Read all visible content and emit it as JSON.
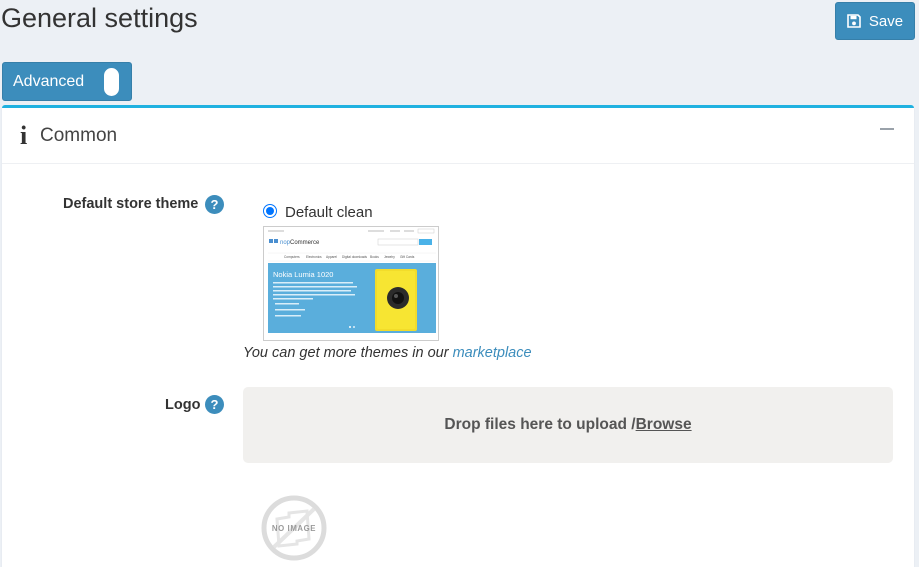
{
  "header": {
    "title": "General settings",
    "save_label": "Save",
    "advanced_label": "Advanced",
    "advanced_on": true
  },
  "card": {
    "title": "Common",
    "accent_color": "#1fb1e0"
  },
  "theme": {
    "label": "Default store theme",
    "option_label": "Default clean",
    "selected": true,
    "preview": {
      "logo_part1": "nop",
      "logo_part2": "Commerce",
      "menu": [
        "Computers",
        "Electronics",
        "Apparel",
        "Digital downloads",
        "Books",
        "Jewelry",
        "Gift Cards"
      ],
      "banner_title": "Nokia Lumia 1020"
    },
    "note_prefix": "You can get more themes in our ",
    "note_link": "marketplace"
  },
  "logo": {
    "label": "Logo",
    "drop_text": "Drop files here to upload / ",
    "browse_label": "Browse",
    "no_image_text": "NO IMAGE"
  },
  "icons": {
    "save": "floppy-disk-icon",
    "info": "info-icon",
    "collapse": "minus-icon",
    "help": "question-icon"
  },
  "colors": {
    "primary": "#3c8dbc",
    "background": "#ecf0f5",
    "radio": "#0075ff"
  }
}
